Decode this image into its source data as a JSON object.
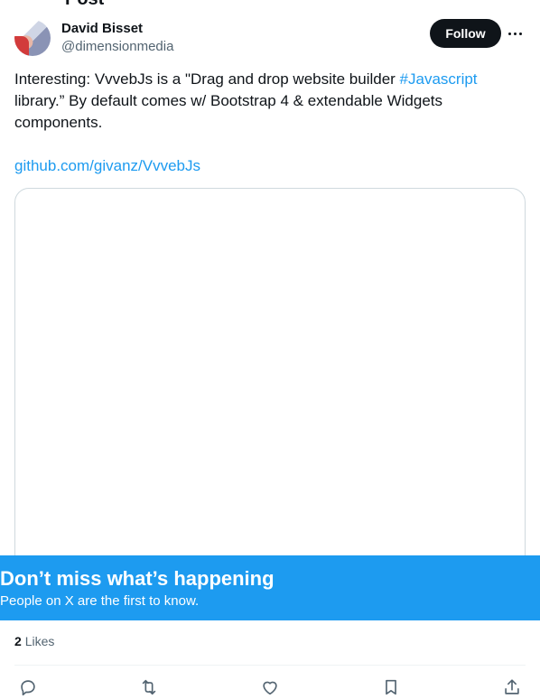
{
  "header": {
    "title": "Post"
  },
  "author": {
    "display_name": "David Bisset",
    "handle": "@dimensionmedia",
    "follow_label": "Follow"
  },
  "tweet": {
    "text_before": "Interesting: VvvebJs is a \"Drag and drop website builder ",
    "hashtag": "#Javascript",
    "text_after": " library.” By default comes w/ Bootstrap 4 & extendable Widgets components.",
    "link": "github.com/givanz/VvvebJs"
  },
  "banner": {
    "title": "Don’t miss what’s happening",
    "subtitle": "People on X are the first to know."
  },
  "stats": {
    "likes_count": "2",
    "likes_label": "Likes"
  },
  "actions": {
    "icons": [
      "reply-icon",
      "repost-icon",
      "like-icon",
      "bookmark-icon",
      "share-icon"
    ]
  },
  "colors": {
    "accent": "#1d9bf0",
    "text": "#0f1419",
    "muted": "#536471",
    "border": "#cfd9de"
  }
}
